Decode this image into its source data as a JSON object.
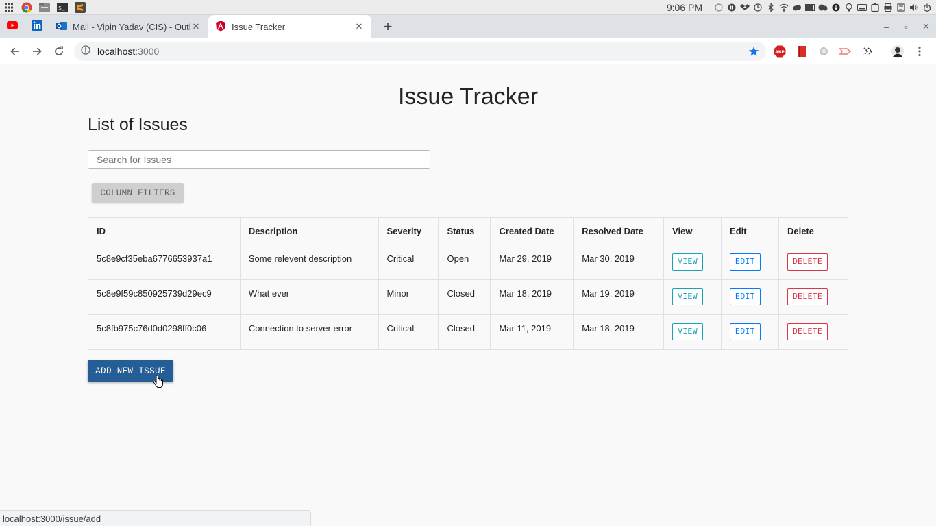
{
  "os": {
    "time": "9:06 PM"
  },
  "browser": {
    "tabs": [
      {
        "title": "Mail - Vipin Yadav (CIS) - Outlook",
        "close": "✕"
      },
      {
        "title": "Issue Tracker",
        "close": "✕"
      }
    ],
    "new_tab": "+",
    "url_host": "localhost",
    "url_port": ":3000",
    "window_controls": {
      "minimize": "–",
      "maximize": "▫",
      "close": "✕"
    }
  },
  "page": {
    "title": "Issue Tracker",
    "list_title": "List of Issues",
    "search_placeholder": "Search for Issues",
    "column_filters_label": "COLUMN FILTERS",
    "table": {
      "headers": [
        "ID",
        "Description",
        "Severity",
        "Status",
        "Created Date",
        "Resolved Date",
        "View",
        "Edit",
        "Delete"
      ],
      "rows": [
        {
          "id": "5c8e9cf35eba6776653937a1",
          "description": "Some relevent description",
          "severity": "Critical",
          "status": "Open",
          "created": "Mar 29, 2019",
          "resolved": "Mar 30, 2019",
          "view": "VIEW",
          "edit": "EDIT",
          "delete": "DELETE"
        },
        {
          "id": "5c8e9f59c850925739d29ec9",
          "description": "What ever",
          "severity": "Minor",
          "status": "Closed",
          "created": "Mar 18, 2019",
          "resolved": "Mar 19, 2019",
          "view": "VIEW",
          "edit": "EDIT",
          "delete": "DELETE"
        },
        {
          "id": "5c8fb975c76d0d0298ff0c06",
          "description": "Connection to server error",
          "severity": "Critical",
          "status": "Closed",
          "created": "Mar 11, 2019",
          "resolved": "Mar 18, 2019",
          "view": "VIEW",
          "edit": "EDIT",
          "delete": "DELETE"
        }
      ]
    },
    "add_button_label": "ADD NEW ISSUE"
  },
  "status_bar": {
    "url": "localhost:3000/issue/add"
  },
  "colors": {
    "primary_button": "#255d96",
    "view": "#17a2b8",
    "edit": "#007bff",
    "delete": "#dc3545"
  }
}
